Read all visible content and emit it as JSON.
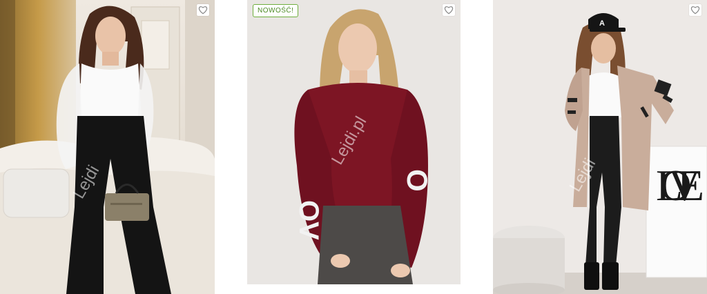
{
  "products": [
    {
      "watermark": "Lejdi",
      "favorite_icon": "heart-outline-icon",
      "photo": "woman in white bodysuit with sheer sleeves, black trousers, holding handbag, seated beside fur sofa"
    },
    {
      "badge": "NOWOŚĆ!",
      "watermark": "Lejdi.pl",
      "favorite_icon": "heart-outline-icon",
      "sleeve_text_left": "OV",
      "sleeve_text_right": "O",
      "photo": "woman in burgundy cropped sweater with lettering on sleeves and grey trousers"
    },
    {
      "watermark": "Lejdi",
      "favorite_icon": "heart-outline-icon",
      "cap_letter": "A",
      "sign_text": "LOVE",
      "photo": "woman in black cap, white top, beige cardigan with black lettering, black leather leggings"
    }
  ],
  "colors": {
    "badge_border": "#6fae3d",
    "badge_text": "#4c8a24",
    "sweater": "#7d1524",
    "cardigan": "#c9ad9b"
  }
}
